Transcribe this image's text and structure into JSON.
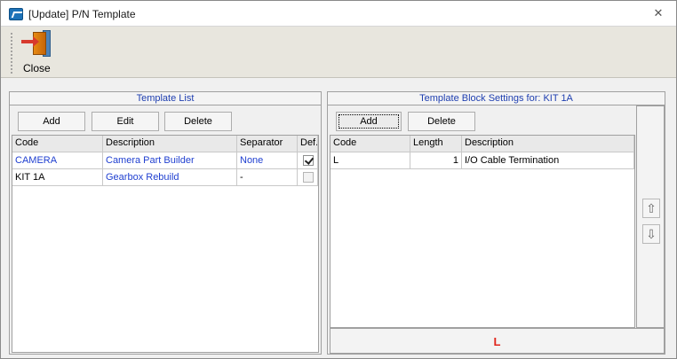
{
  "window": {
    "title": "[Update] P/N Template",
    "close_glyph": "✕",
    "app_icon": "app-icon"
  },
  "toolbar": {
    "close_label": "Close",
    "close_icon": "exit-door-icon"
  },
  "template_list": {
    "header": "Template List",
    "buttons": {
      "add": "Add",
      "edit": "Edit",
      "delete": "Delete"
    },
    "columns": [
      "Code",
      "Description",
      "Separator",
      "Def."
    ],
    "rows": [
      {
        "code": "CAMERA",
        "description": "Camera Part Builder",
        "separator": "None",
        "default": true
      },
      {
        "code": "KIT 1A",
        "description": "Gearbox Rebuild",
        "separator": "-",
        "default": false
      }
    ]
  },
  "block_settings": {
    "header": "Template Block Settings for: KIT 1A",
    "buttons": {
      "add": "Add",
      "delete": "Delete"
    },
    "columns": [
      "Code",
      "Length",
      "Description"
    ],
    "rows": [
      {
        "code": "L",
        "length": "1",
        "description": "I/O Cable Termination"
      }
    ],
    "move_up_glyph": "⇧",
    "move_down_glyph": "⇩",
    "preview": "L"
  },
  "colors": {
    "link_blue": "#1f3fd0",
    "header_blue": "#1f3fb0",
    "preview_red": "#e0261c"
  }
}
